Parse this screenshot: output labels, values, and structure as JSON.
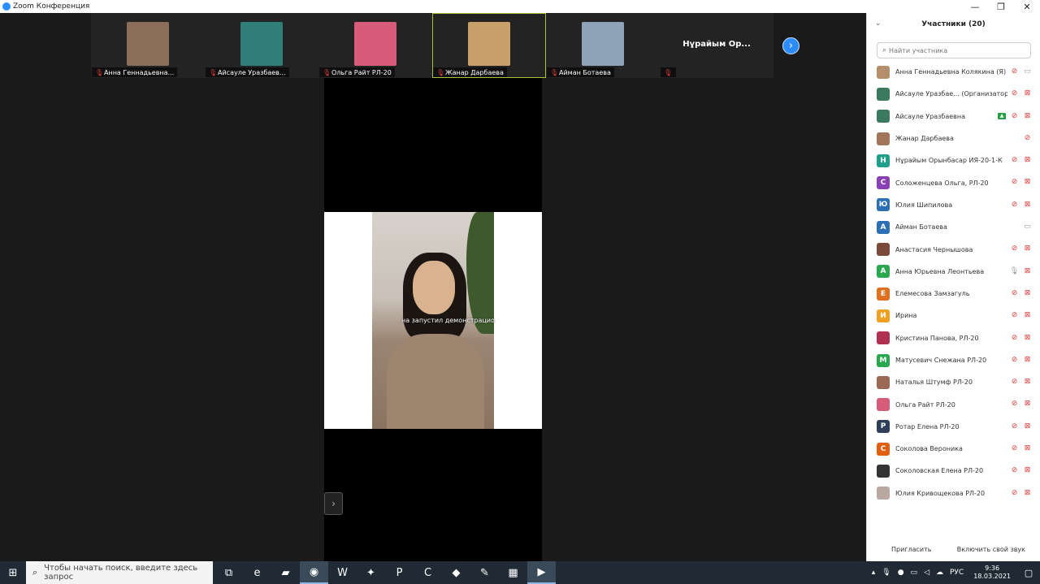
{
  "window": {
    "title": "Zoom Конференция",
    "minimize": "—",
    "restore": "❐",
    "close": "✕"
  },
  "strip": {
    "tiles": [
      {
        "name": "Анна Геннадьевна...",
        "face": "#8a6e5a",
        "active": false
      },
      {
        "name": "Айсауле Уразбаев...",
        "face": "#2f7f78",
        "active": false
      },
      {
        "name": "Ольга Райт РЛ-20",
        "face": "#d65c7a",
        "active": false
      },
      {
        "name": "Жанар Дарбаева",
        "face": "#c7a06a",
        "active": true
      },
      {
        "name": "Айман Ботаева",
        "face": "#8fa3b8",
        "active": false
      },
      {
        "name": "",
        "big": "Нұрайым Орынбасар ИЯ-20-1-К",
        "big_display": "Нұрайым  Ор...",
        "active": false
      }
    ],
    "next_arrow": "›"
  },
  "main": {
    "overlay_text": "Она запустила демонстрацию",
    "overlay_display": "на запустил демонстрацио",
    "side_arrow": "›"
  },
  "panel": {
    "title": "Участники (20)",
    "collapse_icon": "⌄",
    "search_placeholder": "Найти участника",
    "participants": [
      {
        "name": "Анна Геннадьевна Колякина (Я)",
        "avatar": "",
        "color": "#b58e6b",
        "mic": "off",
        "cam": "on"
      },
      {
        "name": "Айсауле Уразбае... (Организатор)",
        "avatar": "",
        "color": "#3b7a5f",
        "mic": "off",
        "cam": "off"
      },
      {
        "name": "Айсауле Уразбаевна",
        "avatar": "",
        "color": "#3b7a5f",
        "mic": "off",
        "cam": "off",
        "share": true
      },
      {
        "name": "Жанар Дарбаева",
        "avatar": "",
        "color": "#a1765a",
        "mic": "off",
        "cam": "none"
      },
      {
        "name": "Нұрайым Орынбасар ИЯ-20-1-К",
        "avatar": "Н",
        "color": "#1f9e8a",
        "mic": "off",
        "cam": "off"
      },
      {
        "name": "Соложенцева Ольга, РЛ-20",
        "avatar": "С",
        "color": "#8b3fb5",
        "mic": "off",
        "cam": "off"
      },
      {
        "name": "Юлия Шипилова",
        "avatar": "Ю",
        "color": "#2c6fb5",
        "mic": "off",
        "cam": "off"
      },
      {
        "name": "Айман Ботаева",
        "avatar": "А",
        "color": "#2c6fb5",
        "mic": "none",
        "cam": "on"
      },
      {
        "name": "Анастасия Чернышова",
        "avatar": "",
        "color": "#7a4a3a",
        "mic": "off",
        "cam": "off"
      },
      {
        "name": "Анна Юрьевна Леонтьева",
        "avatar": "А",
        "color": "#2aa84f",
        "mic": "on",
        "cam": "off"
      },
      {
        "name": "Елемесова Замзагуль",
        "avatar": "Е",
        "color": "#e07020",
        "mic": "off",
        "cam": "off"
      },
      {
        "name": "Ирина",
        "avatar": "И",
        "color": "#f0a020",
        "mic": "off",
        "cam": "off"
      },
      {
        "name": "Кристина Панова, РЛ-20",
        "avatar": "",
        "color": "#b03050",
        "mic": "off",
        "cam": "off"
      },
      {
        "name": "Матусевич Снежана РЛ-20",
        "avatar": "М",
        "color": "#2aa84f",
        "mic": "off",
        "cam": "off"
      },
      {
        "name": "Наталья Штумф РЛ-20",
        "avatar": "",
        "color": "#9a6a55",
        "mic": "off",
        "cam": "off"
      },
      {
        "name": "Ольга Райт РЛ-20",
        "avatar": "",
        "color": "#d65c7a",
        "mic": "off",
        "cam": "off"
      },
      {
        "name": "Ротар Елена РЛ-20",
        "avatar": "Р",
        "color": "#2e3f5a",
        "mic": "off",
        "cam": "off"
      },
      {
        "name": "Соколова Вероника",
        "avatar": "С",
        "color": "#e06010",
        "mic": "off",
        "cam": "off"
      },
      {
        "name": "Соколовская Елена РЛ-20",
        "avatar": "",
        "color": "#333333",
        "mic": "off",
        "cam": "off"
      },
      {
        "name": "Юлия Кривощекова РЛ-20",
        "avatar": "",
        "color": "#b8a8a0",
        "mic": "off",
        "cam": "off"
      }
    ],
    "invite": "Пригласить",
    "unmute": "Включить свой звук"
  },
  "taskbar": {
    "start_icon": "⊞",
    "search_icon": "⌕",
    "search_placeholder": "Чтобы начать поиск, введите здесь запрос",
    "apps": [
      {
        "name": "task-view",
        "glyph": "⧉",
        "active": false
      },
      {
        "name": "edge",
        "glyph": "e",
        "active": false
      },
      {
        "name": "explorer",
        "glyph": "▰",
        "active": false
      },
      {
        "name": "chrome",
        "glyph": "◉",
        "active": true
      },
      {
        "name": "word",
        "glyph": "W",
        "active": false
      },
      {
        "name": "app-bird",
        "glyph": "✦",
        "active": false
      },
      {
        "name": "powerpoint",
        "glyph": "P",
        "active": false
      },
      {
        "name": "app-c",
        "glyph": "C",
        "active": false
      },
      {
        "name": "app-orange",
        "glyph": "◆",
        "active": false
      },
      {
        "name": "app-feather",
        "glyph": "✎",
        "active": false
      },
      {
        "name": "calculator",
        "glyph": "▦",
        "active": false
      },
      {
        "name": "zoom",
        "glyph": "▶",
        "active": true
      }
    ],
    "tray": {
      "lang": "РУС",
      "time": "9:36",
      "date": "18.03.2021"
    }
  }
}
